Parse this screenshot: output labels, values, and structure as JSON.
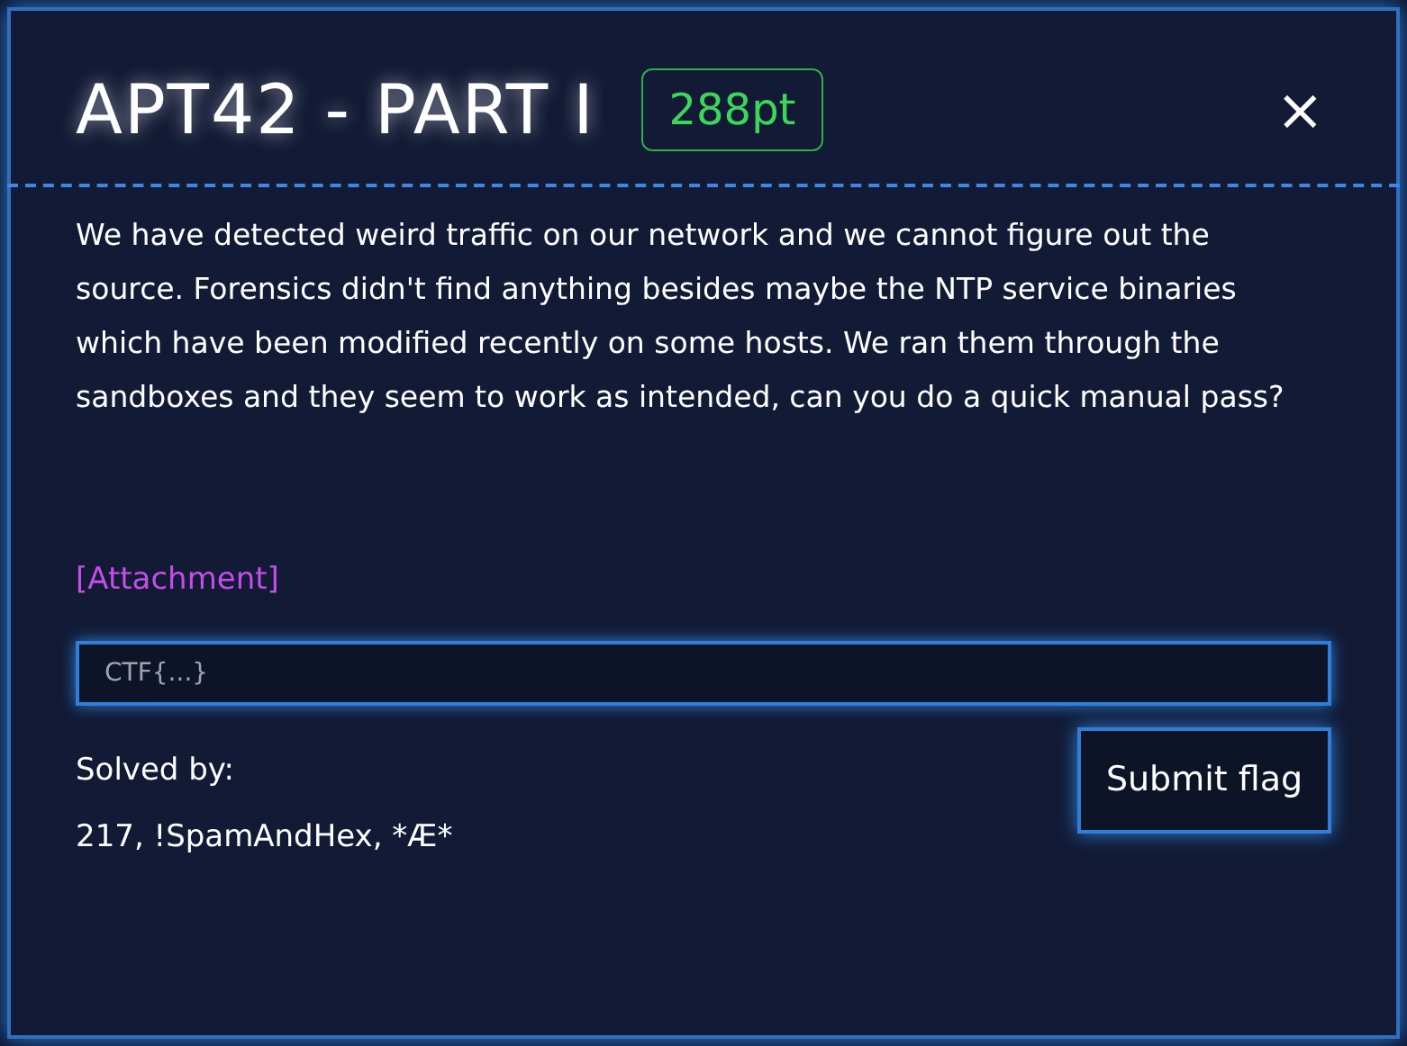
{
  "dialog": {
    "title": "APT42 - PART I",
    "points": "288pt",
    "close": "×",
    "description": "We have detected weird traffic on our network and we cannot figure out the source. Forensics didn't find anything besides maybe the NTP service binaries which have been modified recently on some hosts. We ran them through the sandboxes and they seem to work as intended, can you do a quick manual pass?",
    "attachment": "[Attachment]",
    "flag_field": {
      "placeholder": "CTF{...}"
    },
    "solved_by_label": "Solved by:",
    "solvers": "217, !SpamAndHex, *Æ*",
    "submit": "Submit flag"
  }
}
